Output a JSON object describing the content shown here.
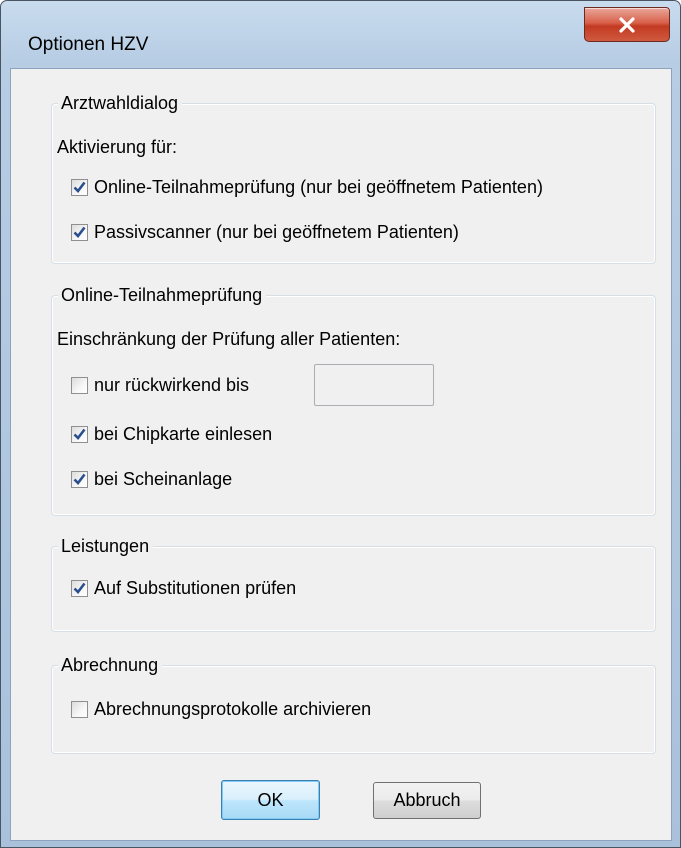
{
  "window": {
    "title": "Optionen HZV",
    "close_icon": "close-x-icon"
  },
  "arztwahl": {
    "legend": "Arztwahldialog",
    "subtitle": "Aktivierung für:",
    "options": [
      {
        "label": "Online-Teilnahmeprüfung (nur bei geöffnetem Patienten)",
        "checked": true
      },
      {
        "label": "Passivscanner (nur bei geöffnetem Patienten)",
        "checked": true
      }
    ]
  },
  "online": {
    "legend": "Online-Teilnahmeprüfung",
    "subtitle": "Einschränkung der Prüfung aller Patienten:",
    "retro_label": "nur rückwirkend bis",
    "retro_checked": false,
    "retro_value": "",
    "options": [
      {
        "label": "bei Chipkarte einlesen",
        "checked": true
      },
      {
        "label": "bei Scheinanlage",
        "checked": true
      }
    ]
  },
  "leistungen": {
    "legend": "Leistungen",
    "option": {
      "label": "Auf Substitutionen prüfen",
      "checked": true
    }
  },
  "abrechnung": {
    "legend": "Abrechnung",
    "option": {
      "label": "Abrechnungsprotokolle archivieren",
      "checked": false
    }
  },
  "buttons": {
    "ok": "OK",
    "cancel": "Abbruch"
  },
  "colors": {
    "title_bar": "#b7cde4",
    "client_bg": "#f0f0f0",
    "close_button": "#c23a22",
    "checkmark": "#2a4f8e",
    "default_button_border": "#3c7fb1"
  }
}
